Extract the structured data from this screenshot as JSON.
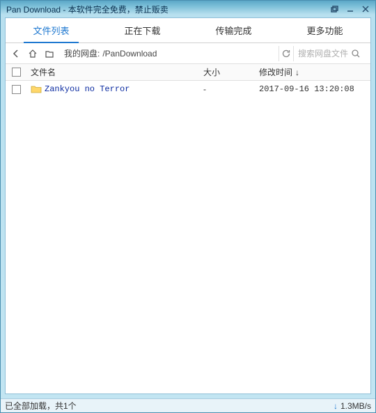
{
  "titlebar": {
    "text": "Pan Download - 本软件完全免费，禁止贩卖"
  },
  "tabs": {
    "file_list": "文件列表",
    "downloading": "正在下载",
    "completed": "传输完成",
    "more": "更多功能"
  },
  "toolbar": {
    "path_label": "我的网盘:",
    "path_value": "/PanDownload",
    "search_placeholder": "搜索网盘文件"
  },
  "columns": {
    "name": "文件名",
    "size": "大小",
    "time": "修改时间"
  },
  "rows": [
    {
      "name": "Zankyou no Terror",
      "size": "-",
      "time": "2017-09-16 13:20:08"
    }
  ],
  "status": {
    "left": "已全部加载，共1个",
    "speed": "1.3MB/s"
  }
}
